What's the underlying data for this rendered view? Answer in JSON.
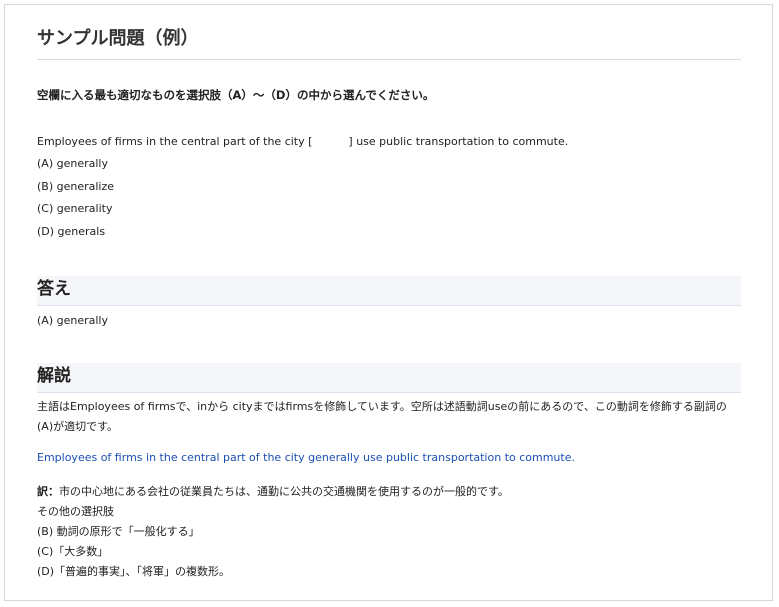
{
  "page": {
    "title": "サンプル問題（例）",
    "instruction": "空欄に入る最も適切なものを選択肢（A）～（D）の中から選んでください。"
  },
  "question": {
    "before_blank": "Employees of firms in the central part of the city [",
    "after_blank": "] use public transportation to commute.",
    "choices": [
      "(A) generally",
      "(B) generalize",
      "(C) generality",
      "(D) generals"
    ]
  },
  "answer": {
    "heading": "答え",
    "text": "(A) generally"
  },
  "explanation": {
    "heading": "解説",
    "body": "主語はEmployees of firmsで、inから cityまではfirmsを修飾しています。空所は述語動詞useの前にあるので、この動詞を修飾する副詞の(A)が適切です。",
    "example_sentence": "Employees of firms in the central part of the city generally use public transportation to commute.",
    "translation_label": "訳：",
    "translation_text": "市の中心地にある会社の従業員たちは、通勤に公共の交通機関を使用するのが一般的です。",
    "others_label": "その他の選択肢",
    "others": [
      "(B) 動詞の原形で「一般化する」",
      "(C)「大多数」",
      "(D)「普遍的事実」、「将軍」の複数形。"
    ]
  },
  "colors": {
    "example_text": "#1a4fb3",
    "section_background": "#f5f6f9"
  }
}
